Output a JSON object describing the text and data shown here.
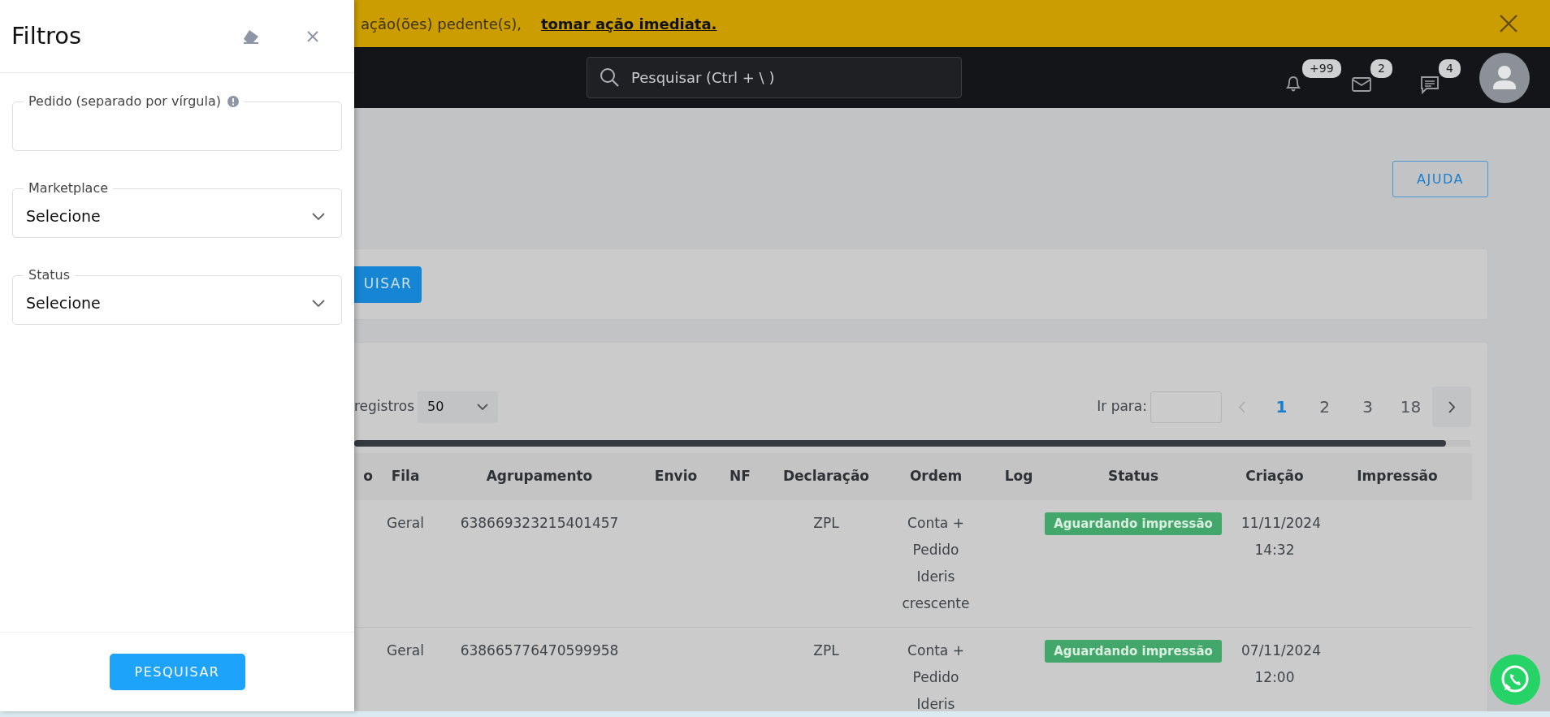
{
  "banner": {
    "text": "ação(ões) pedente(s),",
    "link": "tomar ação imediata."
  },
  "navbar": {
    "search": {
      "placeholder": "Pesquisar (Ctrl + \\ )"
    },
    "notifications": [
      {
        "kind": "bell",
        "count": "+99"
      },
      {
        "kind": "mail",
        "count": "2"
      },
      {
        "kind": "chat",
        "count": "4"
      }
    ]
  },
  "page": {
    "help_button": "AJUDA",
    "search_button": "UISAR"
  },
  "results": {
    "page_size_label": "registros",
    "page_size": "50",
    "goto_label": "Ir para:",
    "pages": [
      {
        "label": "1",
        "selected": true
      },
      {
        "label": "2",
        "selected": false
      },
      {
        "label": "3",
        "selected": false
      },
      {
        "label": "18",
        "selected": false
      }
    ],
    "columns": [
      "o",
      "Fila",
      "Agrupamento",
      "Envio",
      "NF",
      "Declaração",
      "Ordem",
      "Log",
      "Status",
      "Criação",
      "Impressão"
    ],
    "rows": [
      {
        "fila": "Geral",
        "agrupamento": "638669323215401457",
        "declaracao": "ZPL",
        "ordem": "Conta + Pedido Ideris crescente",
        "status": "Aguardando impressão",
        "criacao": "11/11/2024 14:32"
      },
      {
        "fila": "Geral",
        "agrupamento": "638665776470599958",
        "declaracao": "ZPL",
        "ordem": "Conta + Pedido Ideris",
        "status": "Aguardando impressão",
        "criacao": "07/11/2024 12:00"
      }
    ]
  },
  "filters": {
    "title": "Filtros",
    "fields": [
      {
        "kind": "text",
        "label": "Pedido (separado por vírgula)",
        "info": true
      },
      {
        "kind": "select",
        "label": "Marketplace",
        "value": "Selecione",
        "info": false
      },
      {
        "kind": "select",
        "label": "Status",
        "value": "Selecione",
        "info": false
      }
    ],
    "submit": "PESQUISAR"
  }
}
